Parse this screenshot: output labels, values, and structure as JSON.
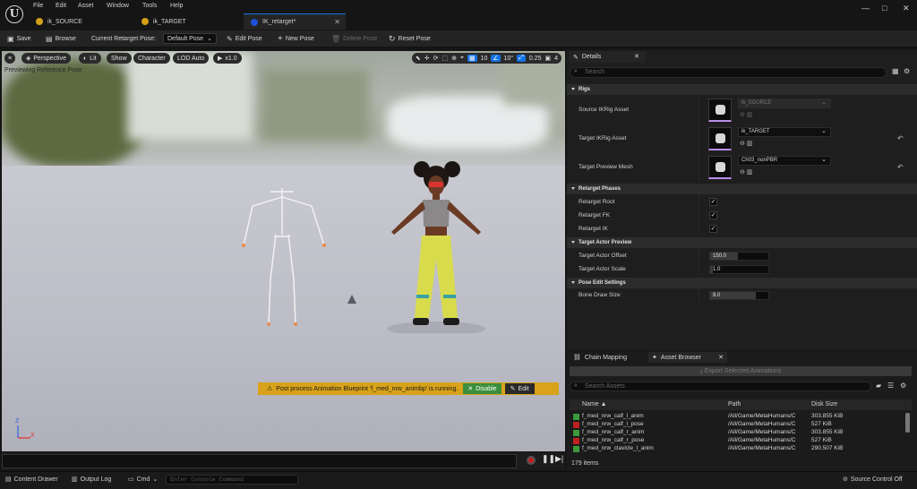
{
  "menu": [
    "File",
    "Edit",
    "Asset",
    "Window",
    "Tools",
    "Help"
  ],
  "tabs": [
    {
      "label": "ik_SOURCE",
      "active": false
    },
    {
      "label": "ik_TARGET",
      "active": false
    },
    {
      "label": "IK_retarget*",
      "active": true
    }
  ],
  "window_controls": [
    "—",
    "□",
    "✕"
  ],
  "toolbar": {
    "save": "Save",
    "browse": "Browse",
    "current_pose_label": "Current Retarget Pose:",
    "current_pose_value": "Default Pose",
    "edit_pose": "Edit Pose",
    "new_pose": "New Pose",
    "delete_pose": "Delete Pose",
    "reset_pose": "Reset Pose"
  },
  "viewport": {
    "perspective": "Perspective",
    "lit": "Lit",
    "show": "Show",
    "character": "Character",
    "lod": "LOD Auto",
    "play_speed": "x1.0",
    "grid_snap": "10",
    "angle_snap": "10°",
    "scale_snap": "0.25",
    "camera_speed": "4",
    "preview_label": "Previewing Reference Pose",
    "notification": "Post process Animation Blueprint 'f_med_nrw_animbp' is running.",
    "disable": "Disable",
    "edit": "Edit",
    "axis_z": "Z",
    "axis_x": "X"
  },
  "details": {
    "tab": "Details",
    "search_placeholder": "Search",
    "sections": {
      "rigs": "Rigs",
      "phases": "Retarget Phases",
      "actor_preview": "Target Actor Preview",
      "pose_edit": "Pose Edit Settings"
    },
    "source_ikrig_label": "Source IKRig Asset",
    "source_ikrig_value": "ik_SOURCE",
    "target_ikrig_label": "Target IKRig Asset",
    "target_ikrig_value": "ik_TARGET",
    "target_mesh_label": "Target Preview Mesh",
    "target_mesh_value": "Ch03_nonPBR",
    "retarget_root": "Retarget Root",
    "retarget_fk": "Retarget FK",
    "retarget_ik": "Retarget IK",
    "retarget_root_checked": true,
    "retarget_fk_checked": true,
    "retarget_ik_checked": true,
    "target_offset_label": "Target Actor Offset",
    "target_offset_value": "150.0",
    "target_scale_label": "Target Actor Scale",
    "target_scale_value": "1.0",
    "bone_draw_label": "Bone Draw Size",
    "bone_draw_value": "8.0"
  },
  "asset_browser": {
    "tab_chain": "Chain Mapping",
    "tab_browser": "Asset Browser",
    "export_button": "Export Selected Animations",
    "search_placeholder": "Search Assets",
    "columns": [
      "Name",
      "Path",
      "Disk Size"
    ],
    "rows": [
      {
        "name": "f_med_nrw_calf_l_anim",
        "path": "/All/Game/MetaHumans/C",
        "size": "303.855 KiB",
        "color": "#3c9a3c"
      },
      {
        "name": "f_med_nrw_calf_l_pose",
        "path": "/All/Game/MetaHumans/C",
        "size": "527 KiB",
        "color": "#c02020"
      },
      {
        "name": "f_med_nrw_calf_r_anim",
        "path": "/All/Game/MetaHumans/C",
        "size": "303.855 KiB",
        "color": "#3c9a3c"
      },
      {
        "name": "f_med_nrw_calf_r_pose",
        "path": "/All/Game/MetaHumans/C",
        "size": "527 KiB",
        "color": "#c02020"
      },
      {
        "name": "f_med_nrw_clavicle_l_anim",
        "path": "/All/Game/MetaHumans/C",
        "size": "290.507 KiB",
        "color": "#3c9a3c"
      }
    ],
    "count": "179 items"
  },
  "statusbar": {
    "content_drawer": "Content Drawer",
    "output_log": "Output Log",
    "cmd": "Cmd",
    "console_placeholder": "Enter Console Command",
    "source_control": "Source Control Off"
  }
}
